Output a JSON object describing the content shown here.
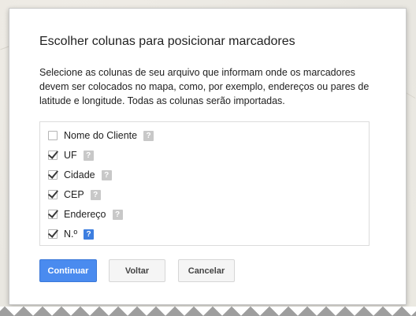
{
  "dialog": {
    "title": "Escolher colunas para posicionar marcadores",
    "description": "Selecione as colunas de seu arquivo que informam onde os marcadores devem ser colocados no mapa, como, por exemplo, endereços ou pares de latitude e longitude. Todas as colunas serão importadas.",
    "columns": [
      {
        "label": "Nome do Cliente",
        "checked": false,
        "help": "?"
      },
      {
        "label": "UF",
        "checked": true,
        "help": "?"
      },
      {
        "label": "Cidade",
        "checked": true,
        "help": "?"
      },
      {
        "label": "CEP",
        "checked": true,
        "help": "?"
      },
      {
        "label": "Endereço",
        "checked": true,
        "help": "?"
      },
      {
        "label": "N.º",
        "checked": true,
        "help": "?"
      }
    ],
    "buttons": {
      "continue": "Continuar",
      "back": "Voltar",
      "cancel": "Cancelar"
    }
  },
  "colors": {
    "primary_button": "#4a8bef",
    "active_help_icon": "#3d7ee0",
    "inactive_help_icon": "#c8c8c8"
  },
  "icons": {
    "help": "question-mark-square",
    "check": "checkmark"
  }
}
